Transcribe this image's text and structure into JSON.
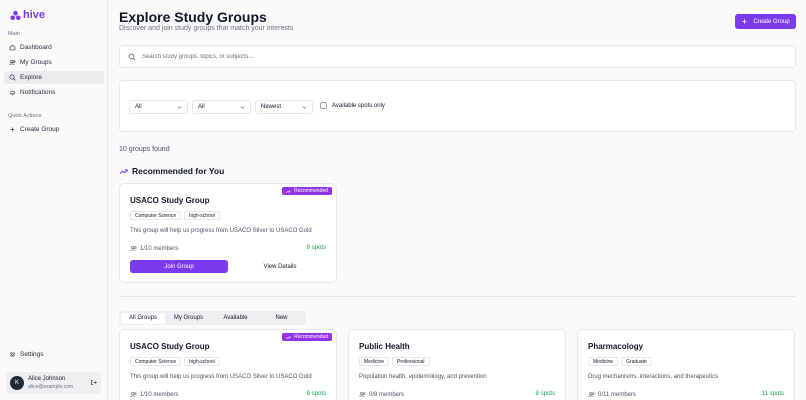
{
  "app": {
    "name": "hive",
    "brand_color": "#7c3aed"
  },
  "sidebar": {
    "main_label": "Main",
    "items": [
      {
        "label": "Dashboard",
        "icon": "home-icon"
      },
      {
        "label": "My Groups",
        "icon": "users-icon"
      },
      {
        "label": "Explore",
        "icon": "search-icon",
        "active": true
      },
      {
        "label": "Notifications",
        "icon": "bell-icon"
      }
    ],
    "quick_label": "Quick Actions",
    "create_group": "Create Group",
    "settings": "Settings",
    "user": {
      "initial": "K",
      "name": "Alice Johnson",
      "email": "alice@example.com"
    }
  },
  "header": {
    "title": "Explore Study Groups",
    "subtitle": "Discover and join study groups that match your interests",
    "create_button": "Create Group"
  },
  "search": {
    "placeholder": "Search study groups, topics, or subjects...",
    "value": ""
  },
  "filters": {
    "select1": "All",
    "select2": "All",
    "sort": "Newest",
    "available_label": "Available spots only"
  },
  "results": {
    "count_text": "10 groups found"
  },
  "recommended": {
    "heading": "Recommended for You",
    "card": {
      "badge": "Recommended",
      "title": "USACO Study Group",
      "tags": [
        "Computer Science",
        "high-school"
      ],
      "description": "This group will help us progress from USACO Silver to USACO Gold",
      "members": "1/10 members",
      "spots": "9 spots",
      "join": "Join Group",
      "view": "View Details"
    }
  },
  "tabs": [
    "All Groups",
    "My Groups",
    "Available",
    "New"
  ],
  "groups": [
    {
      "badge": "Recommended",
      "title": "USACO Study Group",
      "tags": [
        "Computer Science",
        "high-school"
      ],
      "description": "This group will help us progress from USACO Silver to USACO Gold",
      "members": "1/10 members",
      "spots": "9 spots"
    },
    {
      "title": "Public Health",
      "tags": [
        "Medicine",
        "Professional"
      ],
      "description": "Population health, epidemiology, and prevention",
      "members": "0/8 members",
      "spots": "8 spots"
    },
    {
      "title": "Pharmacology",
      "tags": [
        "Medicine",
        "Graduate"
      ],
      "description": "Drug mechanisms, interactions, and therapeutics",
      "members": "0/11 members",
      "spots": "11 spots"
    }
  ]
}
